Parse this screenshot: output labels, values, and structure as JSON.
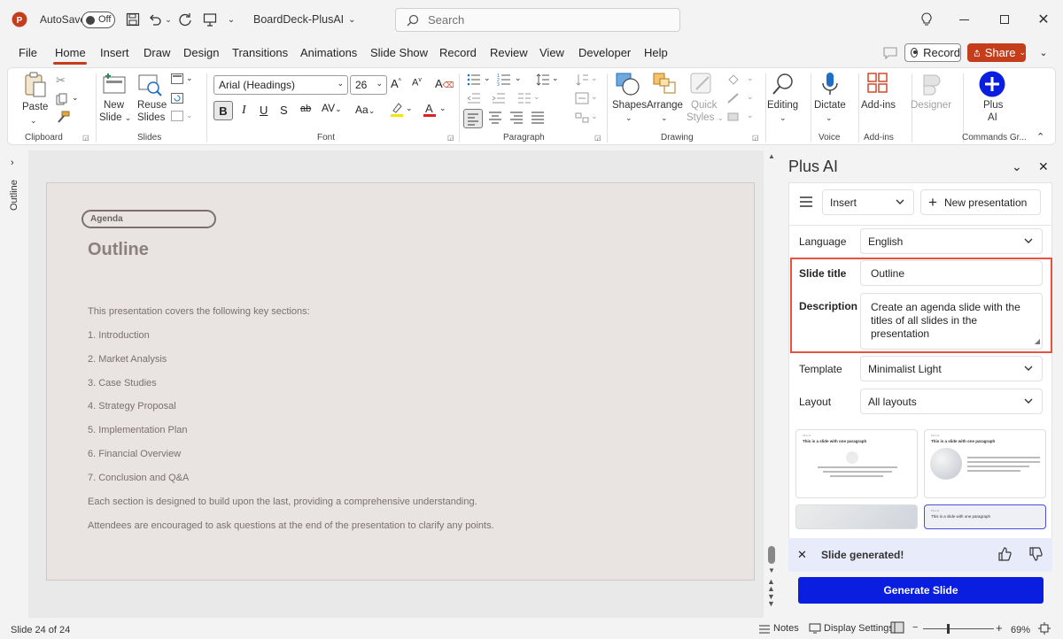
{
  "titlebar": {
    "autosave_label": "AutoSave",
    "autosave_state": "Off",
    "doc_title": "BoardDeck-PlusAI",
    "search_placeholder": "Search"
  },
  "menu": {
    "items": [
      "File",
      "Home",
      "Insert",
      "Draw",
      "Design",
      "Transitions",
      "Animations",
      "Slide Show",
      "Record",
      "Review",
      "View",
      "Developer",
      "Help"
    ],
    "record_btn": "Record",
    "share_btn": "Share"
  },
  "ribbon": {
    "clipboard": {
      "paste": "Paste",
      "label": "Clipboard"
    },
    "slides": {
      "new_slide_1": "New",
      "new_slide_2": "Slide",
      "reuse_1": "Reuse",
      "reuse_2": "Slides",
      "label": "Slides"
    },
    "font": {
      "family": "Arial (Headings)",
      "size": "26",
      "label": "Font"
    },
    "paragraph": {
      "label": "Paragraph"
    },
    "drawing": {
      "shapes": "Shapes",
      "arrange": "Arrange",
      "quick_styles_1": "Quick",
      "quick_styles_2": "Styles",
      "label": "Drawing"
    },
    "editing": {
      "editing": "Editing"
    },
    "voice": {
      "dictate": "Dictate",
      "label": "Voice"
    },
    "addins": {
      "addins": "Add-ins",
      "label": "Add-ins"
    },
    "designer": {
      "designer": "Designer"
    },
    "commands": {
      "plus_1": "Plus",
      "plus_2": "AI",
      "label": "Commands Gr..."
    }
  },
  "outline_strip": {
    "label": "Outline"
  },
  "slide": {
    "tag": "Agenda",
    "title": "Outline",
    "lines": [
      "This presentation covers the following key sections:",
      "1. Introduction",
      "2. Market Analysis",
      "3. Case Studies",
      "4. Strategy Proposal",
      "5. Implementation Plan",
      "6. Financial Overview",
      "7. Conclusion and Q&A",
      "Each section is designed to build upon the last, providing a comprehensive understanding.",
      "Attendees are encouraged to ask questions at the end of the presentation to clarify any points."
    ]
  },
  "pane": {
    "title": "Plus AI",
    "mode": "Insert",
    "new_presentation": "New presentation",
    "language_label": "Language",
    "language_value": "English",
    "slide_title_label": "Slide title",
    "slide_title_value": "Outline",
    "description_label": "Description",
    "description_value": "Create an agenda slide with the titles of all slides in the presentation",
    "template_label": "Template",
    "template_value": "Minimalist Light",
    "layout_label": "Layout",
    "layout_value": "All layouts",
    "thumb_heading": "This is a slide with one paragraph",
    "toast": "Slide generated!",
    "generate_btn": "Generate Slide",
    "highlight_color": "#e8533f",
    "generate_color": "#0a1ee0"
  },
  "status": {
    "slide_count": "Slide 24 of 24",
    "notes": "Notes",
    "display_settings": "Display Settings",
    "zoom": "69%"
  }
}
